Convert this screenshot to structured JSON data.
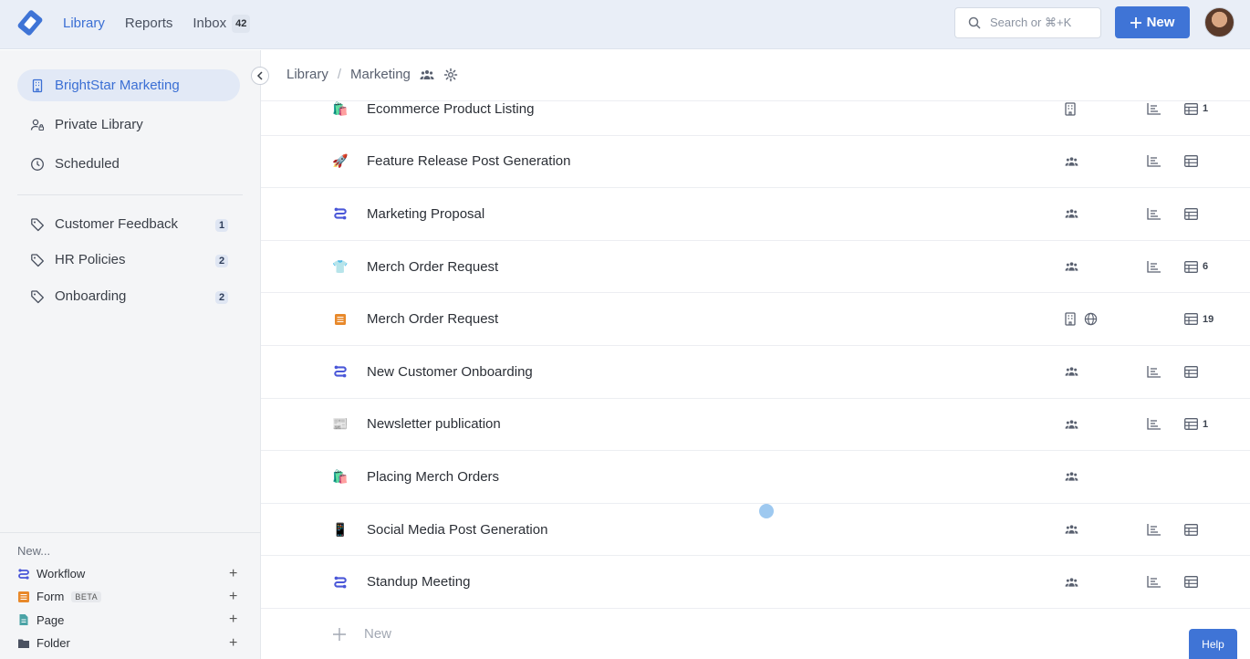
{
  "nav": {
    "library": "Library",
    "reports": "Reports",
    "inbox": "Inbox",
    "inbox_count": "42"
  },
  "search": {
    "placeholder": "Search or ⌘+K"
  },
  "new_button": "New",
  "sidebar": {
    "workspace": "BrightStar Marketing",
    "private_library": "Private Library",
    "scheduled": "Scheduled",
    "tags": [
      {
        "label": "Customer Feedback",
        "count": "1"
      },
      {
        "label": "HR Policies",
        "count": "2"
      },
      {
        "label": "Onboarding",
        "count": "2"
      }
    ],
    "new_section": {
      "title": "New...",
      "items": [
        {
          "label": "Workflow",
          "icon": "workflow-icon"
        },
        {
          "label": "Form",
          "icon": "form-icon",
          "badge": "BETA"
        },
        {
          "label": "Page",
          "icon": "page-icon"
        },
        {
          "label": "Folder",
          "icon": "folder-icon"
        }
      ]
    }
  },
  "breadcrumb": {
    "root": "Library",
    "current": "Marketing"
  },
  "rows": [
    {
      "name": "Ecommerce Product Listing",
      "emoji": "🛍️",
      "count": "1"
    },
    {
      "name": "Feature Release Post Generation",
      "emoji": "🚀",
      "count": ""
    },
    {
      "name": "Marketing Proposal",
      "emoji": "workflow",
      "count": ""
    },
    {
      "name": "Merch Order Request",
      "emoji": "👕",
      "count": "6"
    },
    {
      "name": "Merch Order Request",
      "emoji": "form",
      "count": "19"
    },
    {
      "name": "New Customer Onboarding",
      "emoji": "workflow",
      "count": ""
    },
    {
      "name": "Newsletter publication",
      "emoji": "📰",
      "count": "1"
    },
    {
      "name": "Placing Merch Orders",
      "emoji": "🛍️",
      "count": ""
    },
    {
      "name": "Social Media Post Generation",
      "emoji": "📱",
      "count": ""
    },
    {
      "name": "Standup Meeting",
      "emoji": "workflow",
      "count": ""
    }
  ],
  "new_entry": "New",
  "help": "Help",
  "colors": {
    "accent": "#3f74d6",
    "workflow": "#4a57d8",
    "form": "#e8892b"
  }
}
